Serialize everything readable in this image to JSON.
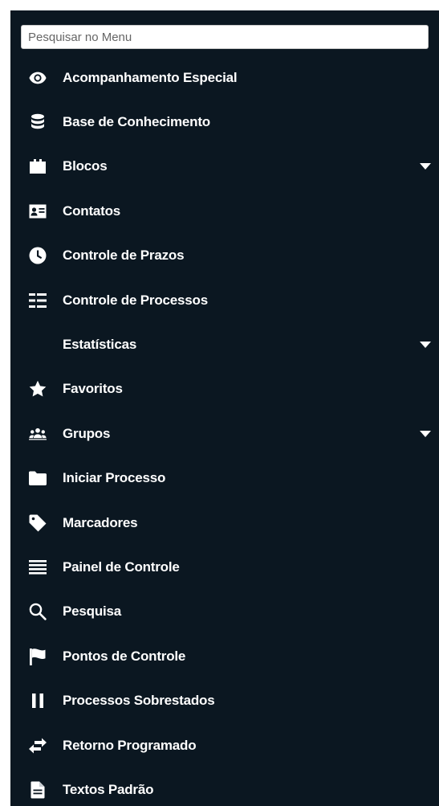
{
  "search": {
    "placeholder": "Pesquisar no Menu",
    "value": ""
  },
  "menu": {
    "items": [
      {
        "label": "Acompanhamento Especial",
        "icon": "eye-icon",
        "has_submenu": false
      },
      {
        "label": "Base de Conhecimento",
        "icon": "database-icon",
        "has_submenu": false
      },
      {
        "label": "Blocos",
        "icon": "blocks-icon",
        "has_submenu": true
      },
      {
        "label": "Contatos",
        "icon": "contact-card-icon",
        "has_submenu": false
      },
      {
        "label": "Controle de Prazos",
        "icon": "clock-icon",
        "has_submenu": false
      },
      {
        "label": "Controle de Processos",
        "icon": "list-view-icon",
        "has_submenu": false
      },
      {
        "label": "Estatísticas",
        "icon": "",
        "has_submenu": true
      },
      {
        "label": "Favoritos",
        "icon": "star-icon",
        "has_submenu": false
      },
      {
        "label": "Grupos",
        "icon": "group-icon",
        "has_submenu": true
      },
      {
        "label": "Iniciar Processo",
        "icon": "folder-icon",
        "has_submenu": false
      },
      {
        "label": "Marcadores",
        "icon": "tag-icon",
        "has_submenu": false
      },
      {
        "label": "Painel de Controle",
        "icon": "lines-icon",
        "has_submenu": false
      },
      {
        "label": "Pesquisa",
        "icon": "search-icon",
        "has_submenu": false
      },
      {
        "label": "Pontos de Controle",
        "icon": "flag-icon",
        "has_submenu": false
      },
      {
        "label": "Processos Sobrestados",
        "icon": "pause-icon",
        "has_submenu": false
      },
      {
        "label": "Retorno Programado",
        "icon": "exchange-icon",
        "has_submenu": false
      },
      {
        "label": "Textos Padrão",
        "icon": "document-icon",
        "has_submenu": false
      }
    ]
  },
  "colors": {
    "background": "#0b1721",
    "text": "#ffffff"
  }
}
